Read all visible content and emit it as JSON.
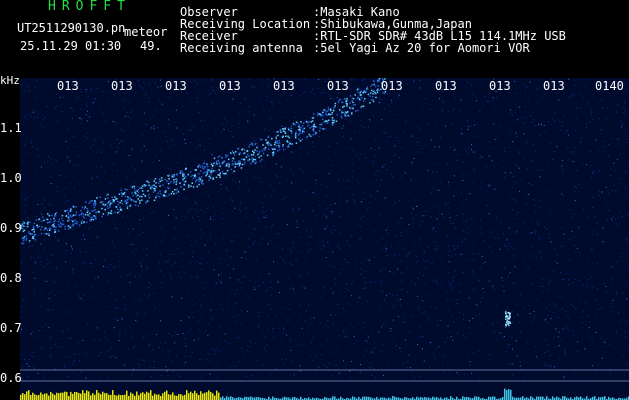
{
  "header": {
    "app_title": "HROFFT",
    "file_name": "UT2511290130.pn",
    "mode": "meteor",
    "date_time": "25.11.29 01:30",
    "count": "49."
  },
  "meta": [
    {
      "label": "Observer",
      "value": ":Masaki Kano"
    },
    {
      "label": "Receiving Location",
      "value": ":Shibukawa,Gunma,Japan"
    },
    {
      "label": "Receiver",
      "value": ":RTL-SDR SDR# 43dB L15 114.1MHz USB"
    },
    {
      "label": "Receiving antenna",
      "value": ":5el Yagi Az 20 for Aomori VOR"
    }
  ],
  "colors": {
    "background": "#000a2c",
    "signal_bright": "#60d0ff",
    "signal_mid": "#2060d0",
    "level_bar": "#e8e800",
    "grid": "#6070a0",
    "title": "#20e040"
  },
  "chart_data": {
    "type": "heatmap",
    "title": "",
    "xlabel": "",
    "ylabel": "kHz",
    "x_tick_labels": [
      "013",
      "013",
      "013",
      "013",
      "013",
      "013",
      "013",
      "013",
      "013",
      "013",
      "0140"
    ],
    "y_tick_labels": [
      "1.1",
      "1.0",
      "0.9",
      "0.8",
      "0.7",
      "0.6"
    ],
    "ylim": [
      0.6,
      1.2
    ],
    "features": [
      {
        "name": "drifting trace",
        "points": [
          [
            0,
            0.89
          ],
          [
            0.1,
            0.93
          ],
          [
            0.2,
            0.97
          ],
          [
            0.3,
            1.01
          ],
          [
            0.4,
            1.06
          ],
          [
            0.5,
            1.12
          ],
          [
            0.6,
            1.19
          ]
        ]
      },
      {
        "name": "meteor echo",
        "x": 0.8,
        "y": 0.72
      }
    ]
  }
}
